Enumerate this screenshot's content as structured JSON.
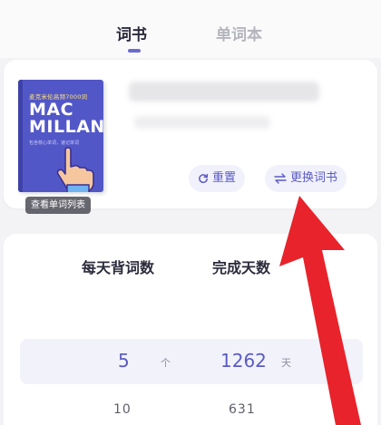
{
  "tabs": [
    {
      "label": "词书",
      "active": true
    },
    {
      "label": "单词本",
      "active": false
    }
  ],
  "book": {
    "cover": {
      "top_text": "麦克米伦高频7000词",
      "title_line1": "MAC",
      "title_line2": "MILLAN",
      "sub_text": "包含核心单词，速记单词"
    },
    "view_list_label": "查看单词列表",
    "reset_label": "重置",
    "change_label": "更换词书"
  },
  "plan": {
    "words_per_day_label": "每天背词数",
    "days_label": "完成天数",
    "selected": {
      "words": "5",
      "words_unit": "个",
      "days": "1262",
      "days_unit": "天"
    },
    "next": {
      "words": "10",
      "days": "631"
    }
  },
  "colors": {
    "accent": "#5a5bc4",
    "arrow": "#e8232b",
    "cover": "#5257c8"
  }
}
